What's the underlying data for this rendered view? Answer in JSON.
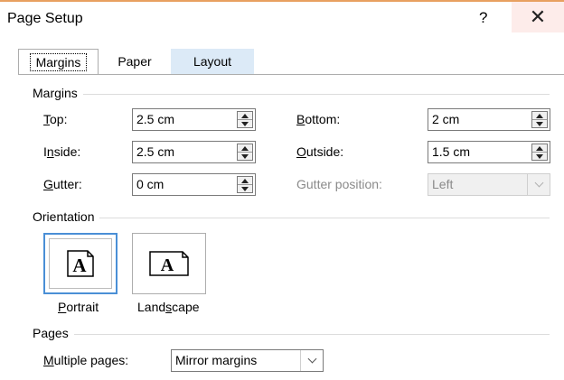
{
  "dialog": {
    "title": "Page Setup",
    "help_label": "?",
    "close_label": "✕"
  },
  "tabs": [
    {
      "label": "Margins",
      "active": true
    },
    {
      "label": "Paper",
      "active": false
    },
    {
      "label": "Layout",
      "active": false
    }
  ],
  "margins": {
    "group_label": "Margins",
    "top": {
      "label_u": "T",
      "label_rest": "op:",
      "value": "2.5 cm"
    },
    "bottom": {
      "label_u": "B",
      "label_rest": "ottom:",
      "value": "2 cm"
    },
    "inside": {
      "label_u": "n",
      "label_pre": "I",
      "label_rest": "side:",
      "value": "2.5 cm"
    },
    "outside": {
      "label_u": "O",
      "label_rest": "utside:",
      "value": "1.5 cm"
    },
    "gutter": {
      "label_u": "G",
      "label_rest": "utter:",
      "value": "0 cm"
    },
    "gutter_position": {
      "label": "Gutter position:",
      "value": "Left",
      "enabled": false
    }
  },
  "orientation": {
    "group_label": "Orientation",
    "portrait": {
      "label_u": "P",
      "label_rest": "ortrait",
      "glyph": "A",
      "selected": true
    },
    "landscape": {
      "label_pre": "Land",
      "label_u": "s",
      "label_rest": "cape",
      "glyph": "A",
      "selected": false
    }
  },
  "pages": {
    "group_label": "Pages",
    "multiple_pages": {
      "label_u": "M",
      "label_rest": "ultiple pages:",
      "value": "Mirror margins"
    }
  },
  "colors": {
    "accent": "#4a8fd6",
    "tab_hover": "#dceaf7",
    "close_hover": "#fdecea"
  },
  "icons": {
    "close": "close-icon",
    "spin": "spin-arrows-icon",
    "dropdown": "chevron-down-icon",
    "page": "page-icon"
  }
}
